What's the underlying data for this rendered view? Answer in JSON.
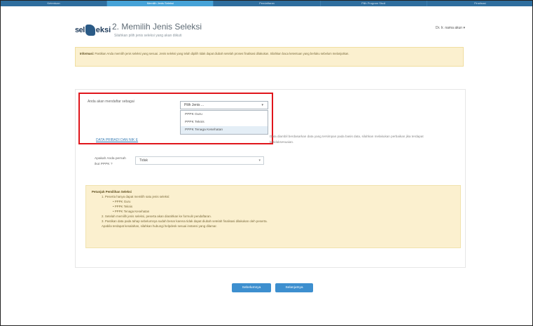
{
  "stepbar": {
    "steps": [
      "Ketentuan",
      "Memilih Jenis Seleksi",
      "Pendaftaran",
      "Pilih Program Studi",
      "Finalisasi"
    ],
    "active_index": 1
  },
  "header": {
    "logo_text": "sel",
    "logo_text2": "eksi",
    "title": "2. Memilih Jenis Seleksi",
    "subtitle": "Silahkan pilih jenis seleksi yang akan diikuti",
    "user_menu": "Dr. Ir. nama akun ▾"
  },
  "notice": {
    "bold": "Informasi:",
    "text": "Pastikan Anda memilih jenis seleksi yang sesuai. Jenis seleksi yang telah dipilih tidak dapat diubah setelah proses finalisasi dilakukan. Silahkan baca ketentuan yang berlaku sebelum melanjutkan."
  },
  "form": {
    "question": "Anda akan mendaftar sebagai",
    "selected": "Pilih Jenis ...",
    "options": [
      "PPPK Guru",
      "PPPK Teknis",
      "PPPK Tenaga Kesehatan"
    ],
    "highlighted_index": 2,
    "info_link": "DATA PRIBADI DAN NIK E",
    "side_note": "Data diambil berdasarkan data yang tersimpan pada basis data, silahkan melakukan perbaikan jika terdapat ketidaksesuaian.",
    "q2_label": "Apakah Anda pernah ikut PPPK ?",
    "q2_value": "Tidak"
  },
  "notes": {
    "title": "Petunjuk Pemilihan Seleksi",
    "lines": [
      {
        "level": 1,
        "text": "1. Peserta hanya dapat memilih satu jenis seleksi:"
      },
      {
        "level": 2,
        "text": "• PPPK Guru"
      },
      {
        "level": 2,
        "text": "• PPPK Teknis"
      },
      {
        "level": 2,
        "text": "• PPPK Tenaga Kesehatan"
      },
      {
        "level": 1,
        "text": "2. Setelah memilih jenis seleksi, peserta akan diarahkan ke formulir pendaftaran."
      },
      {
        "level": 1,
        "text": "3. Pastikan data pada tahap sebelumnya sudah benar karena tidak dapat diubah setelah finalisasi dilakukan oleh peserta."
      },
      {
        "level": 1,
        "text": "   Apabila terdapat kesalahan, silahkan hubungi helpdesk sesuai instansi yang dilamar."
      }
    ]
  },
  "buttons": {
    "back": "Sebelumnya",
    "next": "Selanjutnya"
  }
}
